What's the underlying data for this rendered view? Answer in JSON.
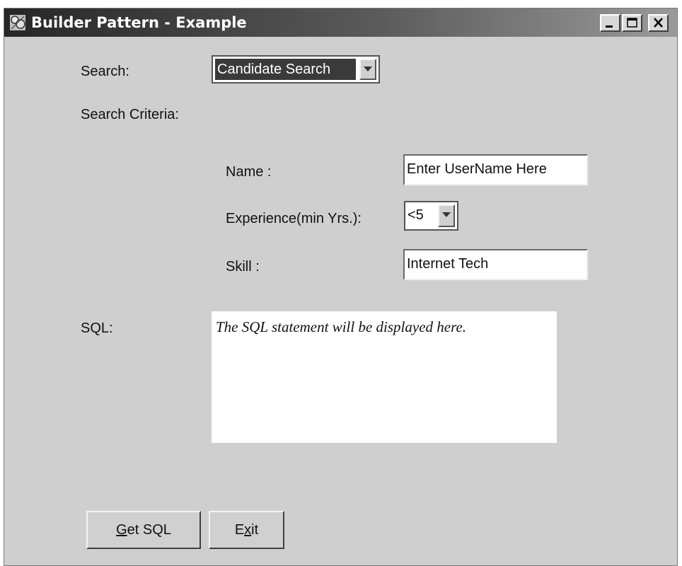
{
  "window": {
    "title": "Builder Pattern - Example",
    "app_icon": "builder-app-icon",
    "controls": [
      "minimize-icon",
      "maximize-icon",
      "close-icon"
    ]
  },
  "search": {
    "label": "Search:",
    "selected": "Candidate Search"
  },
  "criteria": {
    "heading": "Search Criteria:",
    "name_label": "Name :",
    "name_value": "Enter UserName Here",
    "experience_label": "Experience(min Yrs.):",
    "experience_selected": "<5",
    "skill_label": "Skill :",
    "skill_value": "Internet Tech"
  },
  "sql": {
    "label": "SQL:",
    "text": "The SQL statement will be displayed here."
  },
  "buttons": {
    "get_sql_mnemonic": "G",
    "get_sql_rest": "et SQL",
    "exit_pre": "E",
    "exit_mnemonic": "x",
    "exit_rest": "it"
  }
}
